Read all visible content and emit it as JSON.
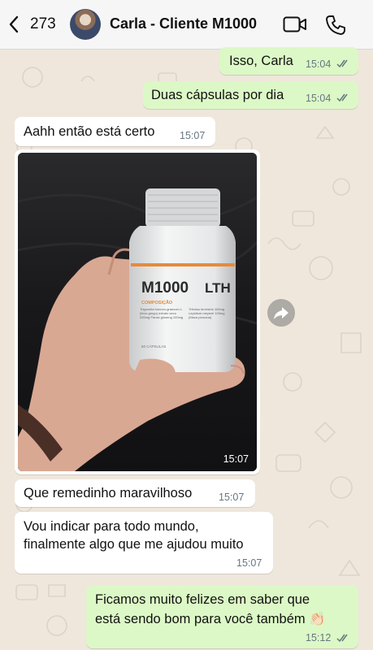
{
  "header": {
    "back_count": "273",
    "contact_name": "Carla - Cliente M1000",
    "icons": [
      "back-chevron-icon",
      "video-call-icon",
      "phone-icon"
    ]
  },
  "messages": [
    {
      "direction": "out",
      "text": "Isso, Carla",
      "time": "15:04",
      "status": "read"
    },
    {
      "direction": "out",
      "text": "Duas cápsulas por dia",
      "time": "15:04",
      "status": "read"
    },
    {
      "direction": "in",
      "text": "Aahh então está certo",
      "time": "15:07"
    },
    {
      "direction": "in",
      "type": "image",
      "time": "15:07",
      "image_text": {
        "brand": "M1000",
        "suffix": "LTH",
        "section": "COMPOSIÇÃO",
        "ingredients_left": "Trigonella foenum-graecum L. (feno-grego) extrato seco 200mg Panax ginseng 100mg",
        "ingredients_right": "Tribulus terrestris 100mg Lepidium meyenii 100mg (Maca peruana)",
        "count": "60 CÁPSULAS"
      }
    },
    {
      "direction": "in",
      "text": "Que remedinho maravilhoso",
      "time": "15:07"
    },
    {
      "direction": "in",
      "lines": [
        "Vou indicar para todo mundo,",
        "finalmente algo que me ajudou muito"
      ],
      "time": "15:07"
    },
    {
      "direction": "out",
      "lines": [
        "Ficamos muito felizes em saber que",
        "está sendo bom para você também 👏🏻"
      ],
      "time": "15:12",
      "status": "read"
    }
  ],
  "colors": {
    "outgoing_bubble": "#dcf8c6",
    "incoming_bubble": "#ffffff",
    "chat_background": "#efe7dc",
    "header_background": "#f6f6f6",
    "read_ticks": "#4fb6ec"
  }
}
